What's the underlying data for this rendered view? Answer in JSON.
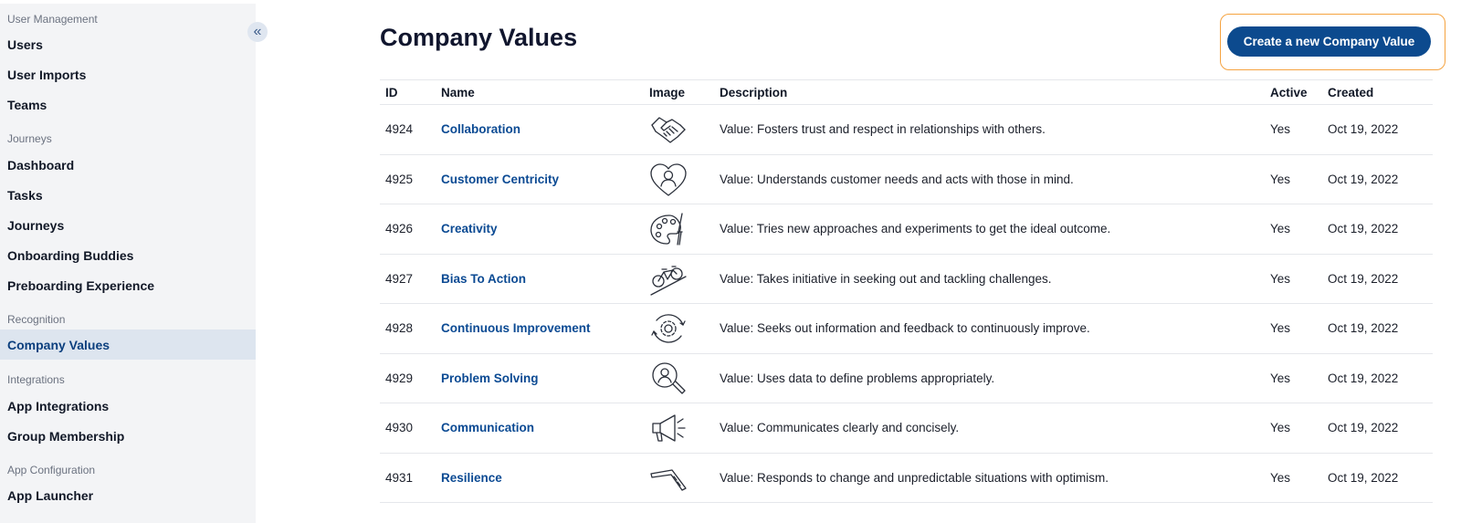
{
  "sidebar": {
    "collapse_icon": "chevrons-left-icon",
    "sections": [
      {
        "label": "User Management",
        "items": [
          "Users",
          "User Imports",
          "Teams"
        ]
      },
      {
        "label": "Journeys",
        "items": [
          "Dashboard",
          "Tasks",
          "Journeys",
          "Onboarding Buddies",
          "Preboarding Experience"
        ]
      },
      {
        "label": "Recognition",
        "items": [
          "Company Values"
        ]
      },
      {
        "label": "Integrations",
        "items": [
          "App Integrations",
          "Group Membership"
        ]
      },
      {
        "label": "App Configuration",
        "items": [
          "App Launcher"
        ]
      }
    ],
    "active_item": "Company Values"
  },
  "page": {
    "title": "Company Values",
    "create_button": "Create a new Company Value"
  },
  "table": {
    "headers": {
      "id": "ID",
      "name": "Name",
      "image": "Image",
      "description": "Description",
      "active": "Active",
      "created": "Created"
    },
    "rows": [
      {
        "id": "4924",
        "name": "Collaboration",
        "image": "handshake-icon",
        "description": "Value: Fosters trust and respect in relationships with others.",
        "active": "Yes",
        "created": "Oct 19, 2022"
      },
      {
        "id": "4925",
        "name": "Customer Centricity",
        "image": "heart-person-icon",
        "description": "Value: Understands customer needs and acts with those in mind.",
        "active": "Yes",
        "created": "Oct 19, 2022"
      },
      {
        "id": "4926",
        "name": "Creativity",
        "image": "palette-icon",
        "description": "Value: Tries new approaches and experiments to get the ideal outcome.",
        "active": "Yes",
        "created": "Oct 19, 2022"
      },
      {
        "id": "4927",
        "name": "Bias To Action",
        "image": "bicycle-uphill-icon",
        "description": "Value: Takes initiative in seeking out and tackling challenges.",
        "active": "Yes",
        "created": "Oct 19, 2022"
      },
      {
        "id": "4928",
        "name": "Continuous Improvement",
        "image": "gear-cycle-icon",
        "description": "Value: Seeks out information and feedback to continuously improve.",
        "active": "Yes",
        "created": "Oct 19, 2022"
      },
      {
        "id": "4929",
        "name": "Problem Solving",
        "image": "magnifier-person-icon",
        "description": "Value: Uses data to define problems appropriately.",
        "active": "Yes",
        "created": "Oct 19, 2022"
      },
      {
        "id": "4930",
        "name": "Communication",
        "image": "megaphone-icon",
        "description": "Value: Communicates clearly and concisely.",
        "active": "Yes",
        "created": "Oct 19, 2022"
      },
      {
        "id": "4931",
        "name": "Resilience",
        "image": "boomerang-icon",
        "description": "Value: Responds to change and unpredictable situations with optimism.",
        "active": "Yes",
        "created": "Oct 19, 2022"
      }
    ]
  }
}
